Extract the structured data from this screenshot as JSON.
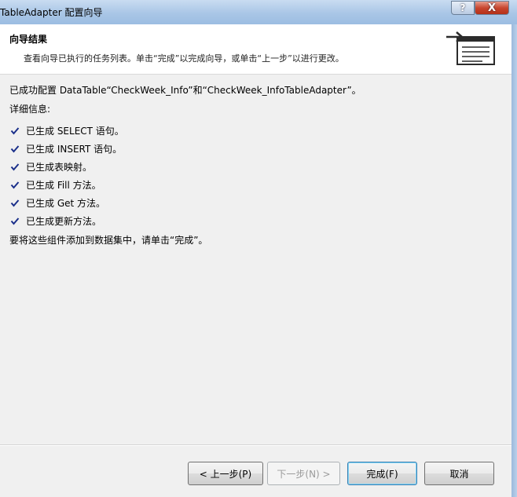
{
  "window": {
    "title": "TableAdapter 配置向导",
    "help_label": "?",
    "close_label": "X"
  },
  "header": {
    "title": "向导结果",
    "subtitle": "查看向导已执行的任务列表。单击“完成”以完成向导，或单击“上一步”以进行更改。",
    "icon": "wizard-summary-icon"
  },
  "content": {
    "intro": "已成功配置 DataTable“CheckWeek_Info”和“CheckWeek_InfoTableAdapter”。",
    "details_label": "详细信息:",
    "steps": [
      {
        "text": "已生成 SELECT 语句。",
        "icon": "checkmark-icon"
      },
      {
        "text": "已生成 INSERT 语句。",
        "icon": "checkmark-icon"
      },
      {
        "text": "已生成表映射。",
        "icon": "checkmark-icon"
      },
      {
        "text": "已生成 Fill 方法。",
        "icon": "checkmark-icon"
      },
      {
        "text": "已生成 Get 方法。",
        "icon": "checkmark-icon"
      },
      {
        "text": "已生成更新方法。",
        "icon": "checkmark-icon"
      }
    ],
    "final_note": "要将这些组件添加到数据集中，请单击“完成”。"
  },
  "buttons": {
    "prev": "< 上一步(P)",
    "next": "下一步(N) >",
    "finish": "完成(F)",
    "cancel": "取消"
  },
  "colors": {
    "check": "#1a2f8a",
    "title_bar": "#a9c6e6",
    "close_button": "#c8462f",
    "default_button_border": "#3c7fb1"
  }
}
